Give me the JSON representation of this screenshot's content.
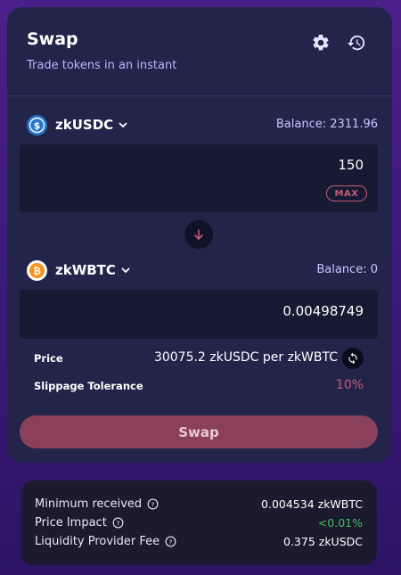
{
  "header": {
    "title": "Swap",
    "subtitle": "Trade tokens in an instant"
  },
  "from": {
    "token": "zkUSDC",
    "balance": "Balance: 2311.96",
    "amount": "150",
    "max_label": "MAX"
  },
  "to": {
    "token": "zkWBTC",
    "balance": "Balance: 0",
    "amount": "0.00498749"
  },
  "details": {
    "price_label": "Price",
    "price_value": "30075.2 zkUSDC per zkWBTC",
    "slippage_label": "Slippage Tolerance",
    "slippage_value": "10%"
  },
  "swap_button": "Swap",
  "summary": {
    "rows": [
      {
        "label": "Minimum received",
        "value": "0.004534 zkWBTC"
      },
      {
        "label": "Price Impact",
        "value": "<0.01%"
      },
      {
        "label": "Liquidity Provider Fee",
        "value": "0.375 zkUSDC"
      }
    ]
  },
  "colors": {
    "accent": "#8a3f5a",
    "slippage": "#c75a78",
    "impact_positive": "#3fbf5a",
    "usdc_icon": "#2775ca",
    "btc_icon": "#f7931a"
  },
  "icons": {
    "settings": "gear-icon",
    "history": "history-icon",
    "swap_direction": "arrow-down-icon",
    "refresh": "refresh-icon",
    "info": "question-circle-icon"
  }
}
